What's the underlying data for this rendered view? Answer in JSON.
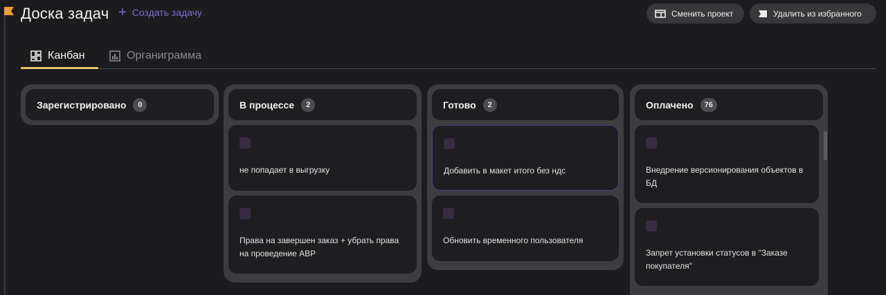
{
  "header": {
    "title": "Доска задач",
    "create_label": "Создать задачу",
    "change_project_label": "Сменить проект",
    "remove_favorite_label": "Удалить из избранного"
  },
  "tabs": [
    {
      "label": "Канбан",
      "active": true
    },
    {
      "label": "Органиграмма",
      "active": false
    }
  ],
  "columns": [
    {
      "title": "Зарегистрировано",
      "count": "0",
      "cards": []
    },
    {
      "title": "В процессе",
      "count": "2",
      "cards": [
        {
          "text": "не попадает в выгрузку"
        },
        {
          "text": "Права на завершен заказ + убрать права на проведение АВР"
        }
      ]
    },
    {
      "title": "Готово",
      "count": "2",
      "cards": [
        {
          "text": "Добавить в макет итого без ндс"
        },
        {
          "text": "Обновить временного пользователя"
        }
      ]
    },
    {
      "title": "Оплачено",
      "count": "76",
      "cards": [
        {
          "text": "Внедрение версионирования объектов в БД"
        },
        {
          "text": "Запрет установки статусов в \"Заказе покупателя\""
        }
      ]
    }
  ],
  "colors": {
    "accent": "#7f6bd6",
    "tab_underline": "#e9c46a",
    "background": "#1c1b1d",
    "flag": "#f0a030"
  },
  "icons": {
    "flag": "bookmark-flag-icon",
    "create": "plus-icon",
    "change_project": "swap-window-icon",
    "remove_favorite": "bookmark-remove-icon",
    "kanban": "kanban-grid-icon",
    "org": "bar-chart-icon"
  }
}
